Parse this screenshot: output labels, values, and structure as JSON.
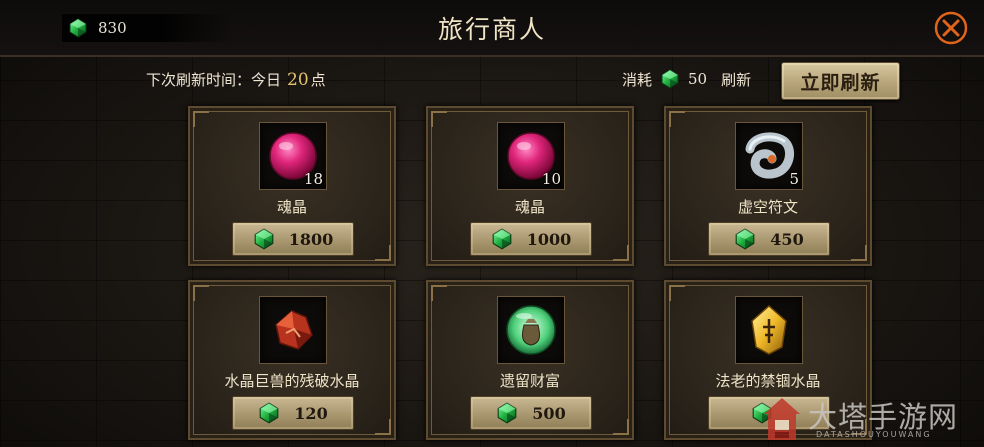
{
  "header": {
    "title": "旅行商人",
    "currency_value": "830"
  },
  "refresh": {
    "next_label": "下次刷新时间：",
    "today_label": "今日",
    "hour": "20",
    "hour_unit": "点",
    "cost_label": "消耗",
    "cost_value": "50",
    "refresh_label": "刷新",
    "button_label": "立即刷新"
  },
  "items": [
    {
      "name": "魂晶",
      "qty": "18",
      "price": "1800",
      "icon": "pink-orb-icon"
    },
    {
      "name": "魂晶",
      "qty": "10",
      "price": "1000",
      "icon": "pink-orb-icon"
    },
    {
      "name": "虚空符文",
      "qty": "5",
      "price": "450",
      "icon": "void-rune-icon"
    },
    {
      "name": "水晶巨兽的残破水晶",
      "qty": "",
      "price": "120",
      "icon": "broken-crystal-icon"
    },
    {
      "name": "遗留财富",
      "qty": "",
      "price": "500",
      "icon": "money-bag-orb-icon"
    },
    {
      "name": "法老的禁锢水晶",
      "qty": "",
      "price": "",
      "icon": "pharaoh-crystal-icon"
    }
  ],
  "watermark": {
    "text": "大塔手游网",
    "sub": "DATASHOUYOUWANG"
  },
  "colors": {
    "gem_green": "#1fae3e",
    "hour_gold": "#e6c46e",
    "frame_brown": "#5c4a31"
  }
}
